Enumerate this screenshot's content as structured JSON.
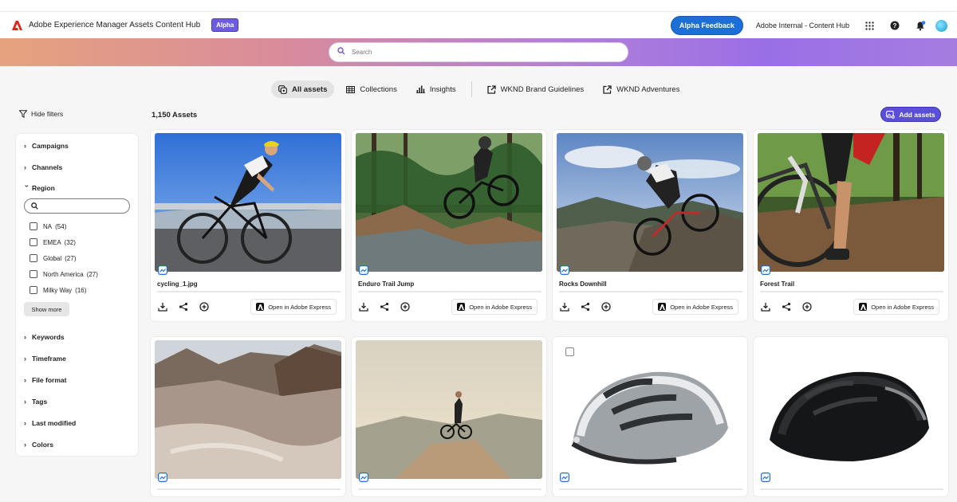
{
  "header": {
    "app_title": "Adobe Experience Manager Assets Content Hub",
    "badge": "Alpha",
    "feedback_label": "Alpha Feedback",
    "org_name": "Adobe Internal - Content Hub",
    "icons": [
      "adobe-logo-icon",
      "apps-grid-icon",
      "help-icon",
      "notifications-bell-icon",
      "avatar"
    ]
  },
  "search": {
    "placeholder": "Search"
  },
  "nav": {
    "tabs": [
      {
        "label": "All assets",
        "icon": "assets-icon",
        "active": true
      },
      {
        "label": "Collections",
        "icon": "collections-icon"
      },
      {
        "label": "Insights",
        "icon": "bar-chart-icon"
      },
      {
        "label": "WKND Brand Guidelines",
        "icon": "external-link-icon"
      },
      {
        "label": "WKND Adventures",
        "icon": "external-link-icon"
      }
    ]
  },
  "toolbar": {
    "hide_filters": "Hide filters",
    "asset_count": "1,150 Assets",
    "add_assets": "Add assets"
  },
  "filters": {
    "groups_top": [
      "Campaigns",
      "Channels"
    ],
    "region": {
      "label": "Region",
      "options": [
        {
          "name": "NA",
          "count": "(54)"
        },
        {
          "name": "EMEA",
          "count": "(32)"
        },
        {
          "name": "Global",
          "count": "(27)"
        },
        {
          "name": "North America",
          "count": "(27)"
        },
        {
          "name": "Milky Way",
          "count": "(16)"
        }
      ],
      "show_more": "Show more"
    },
    "groups_bottom": [
      "Keywords",
      "Timeframe",
      "File format",
      "Tags",
      "Last modified",
      "Colors"
    ]
  },
  "assets": [
    {
      "title": "cycling_1.jpg",
      "open_label": "Open in Adobe Express"
    },
    {
      "title": "Enduro Trail Jump",
      "open_label": "Open in Adobe Express"
    },
    {
      "title": "Rocks Downhill",
      "open_label": "Open in Adobe Express"
    },
    {
      "title": "Forest Trail",
      "open_label": "Open in Adobe Express"
    }
  ],
  "colors": {
    "accent": "#5a4fd6",
    "feedback": "#1d6fd8",
    "badge": "#6e5ce0"
  }
}
